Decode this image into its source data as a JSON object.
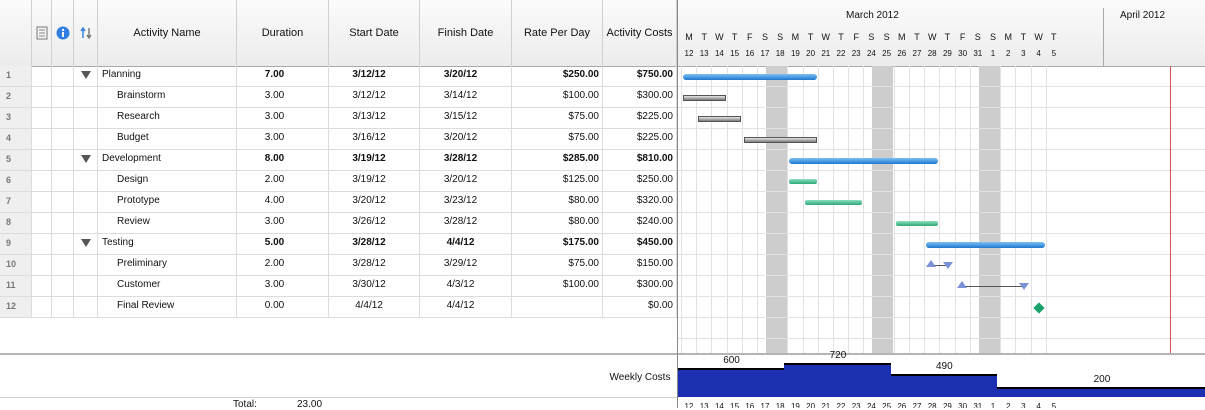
{
  "table": {
    "headers": {
      "name": "Activity Name",
      "duration": "Duration",
      "start": "Start Date",
      "finish": "Finish Date",
      "rate": "Rate Per Day",
      "cost": "Activity Costs"
    },
    "rows": [
      {
        "num": "1",
        "name": "Planning",
        "duration": "7.00",
        "start": "3/12/12",
        "finish": "3/20/12",
        "rate": "$250.00",
        "cost": "$750.00",
        "group": true
      },
      {
        "num": "2",
        "name": "Brainstorm",
        "duration": "3.00",
        "start": "3/12/12",
        "finish": "3/14/12",
        "rate": "$100.00",
        "cost": "$300.00",
        "group": false
      },
      {
        "num": "3",
        "name": "Research",
        "duration": "3.00",
        "start": "3/13/12",
        "finish": "3/15/12",
        "rate": "$75.00",
        "cost": "$225.00",
        "group": false
      },
      {
        "num": "4",
        "name": "Budget",
        "duration": "3.00",
        "start": "3/16/12",
        "finish": "3/20/12",
        "rate": "$75.00",
        "cost": "$225.00",
        "group": false
      },
      {
        "num": "5",
        "name": "Development",
        "duration": "8.00",
        "start": "3/19/12",
        "finish": "3/28/12",
        "rate": "$285.00",
        "cost": "$810.00",
        "group": true
      },
      {
        "num": "6",
        "name": "Design",
        "duration": "2.00",
        "start": "3/19/12",
        "finish": "3/20/12",
        "rate": "$125.00",
        "cost": "$250.00",
        "group": false
      },
      {
        "num": "7",
        "name": "Prototype",
        "duration": "4.00",
        "start": "3/20/12",
        "finish": "3/23/12",
        "rate": "$80.00",
        "cost": "$320.00",
        "group": false
      },
      {
        "num": "8",
        "name": "Review",
        "duration": "3.00",
        "start": "3/26/12",
        "finish": "3/28/12",
        "rate": "$80.00",
        "cost": "$240.00",
        "group": false
      },
      {
        "num": "9",
        "name": "Testing",
        "duration": "5.00",
        "start": "3/28/12",
        "finish": "4/4/12",
        "rate": "$175.00",
        "cost": "$450.00",
        "group": true
      },
      {
        "num": "10",
        "name": "Preliminary",
        "duration": "2.00",
        "start": "3/28/12",
        "finish": "3/29/12",
        "rate": "$75.00",
        "cost": "$150.00",
        "group": false
      },
      {
        "num": "11",
        "name": "Customer",
        "duration": "3.00",
        "start": "3/30/12",
        "finish": "4/3/12",
        "rate": "$100.00",
        "cost": "$300.00",
        "group": false
      },
      {
        "num": "12",
        "name": "Final Review",
        "duration": "0.00",
        "start": "4/4/12",
        "finish": "4/4/12",
        "rate": "",
        "cost": "$0.00",
        "group": false
      }
    ],
    "weekly_costs_label": "Weekly Costs",
    "total_label": "Total:",
    "total_value": "23.00"
  },
  "gantt": {
    "months": [
      "March 2012",
      "April 2012"
    ],
    "day_letters": [
      "M",
      "T",
      "W",
      "T",
      "F",
      "S",
      "S",
      "M",
      "T",
      "W",
      "T",
      "F",
      "S",
      "S",
      "M",
      "T",
      "W",
      "T",
      "F",
      "S",
      "S",
      "M",
      "T",
      "W",
      "T"
    ],
    "day_numbers": [
      "12",
      "13",
      "14",
      "15",
      "16",
      "17",
      "18",
      "19",
      "20",
      "21",
      "22",
      "23",
      "24",
      "25",
      "26",
      "27",
      "28",
      "29",
      "30",
      "31",
      "1",
      "2",
      "3",
      "4",
      "5"
    ],
    "weekly_costs": [
      {
        "label": "600",
        "value": 600
      },
      {
        "label": "720",
        "value": 720
      },
      {
        "label": "490",
        "value": 490
      },
      {
        "label": "200",
        "value": 200
      }
    ],
    "colors": {
      "summary": "#1f78d0",
      "task": "#7a7a7a",
      "design_task": "#2fa777",
      "weekly": "#1b2fb0",
      "today_line": "#e05050",
      "milestone": "#1aa26a"
    }
  },
  "icons": [
    "notes-icon",
    "info-icon",
    "reorder-icon",
    "disclosure-triangle-icon"
  ]
}
